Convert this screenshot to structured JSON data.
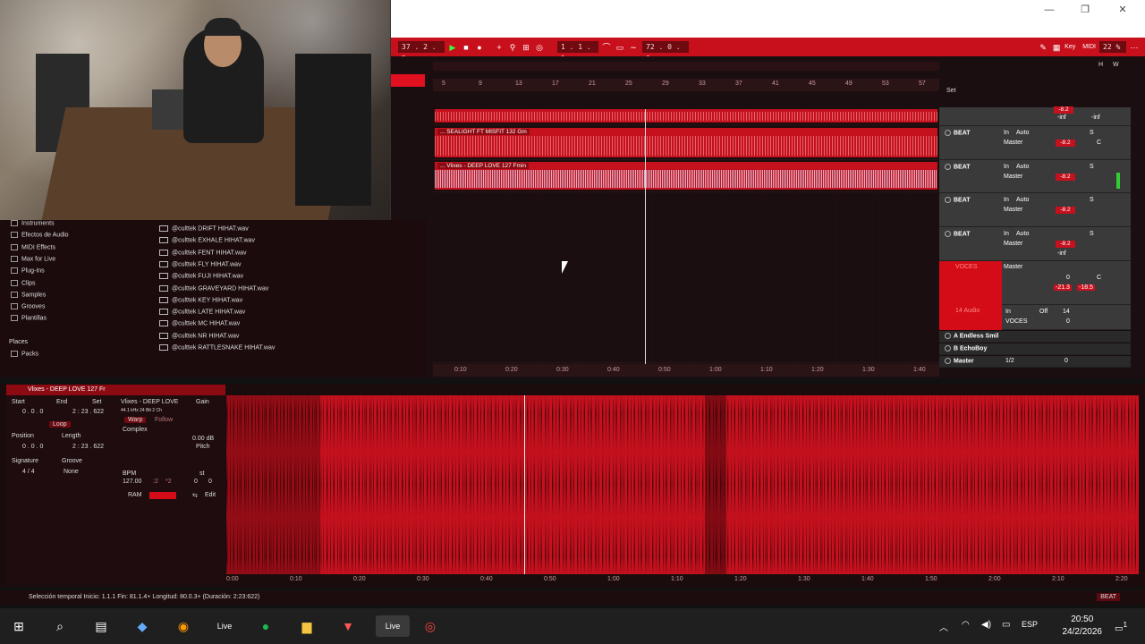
{
  "window": {
    "minimize": "—",
    "restore": "❐",
    "close": "✕"
  },
  "transport": {
    "position": "37 . 2 . 2",
    "loop_start": "1 . 1 . 1",
    "tempo_field": "72 . 0 . 0",
    "key_label": "Key",
    "midi_label": "MIDI",
    "cpu": "22 %",
    "h_label": "H",
    "w_label": "W"
  },
  "session": {
    "set_label": "Set",
    "ruler_marks": [
      "5",
      "9",
      "13",
      "17",
      "21",
      "25",
      "29",
      "33",
      "37",
      "41",
      "45",
      "49",
      "53",
      "57"
    ],
    "time_marks": [
      "0:10",
      "0:20",
      "0:30",
      "0:40",
      "0:50",
      "1:00",
      "1:10",
      "1:20",
      "1:30",
      "1:40"
    ],
    "tracks": [
      {
        "clip": "",
        "name": "BEAT"
      },
      {
        "clip": "... SEALIGHT FT MISFIT 132 Gm",
        "name": "BEAT"
      },
      {
        "clip": "... Vlixes - DEEP LOVE 127 Fmin",
        "name": "BEAT"
      },
      {
        "clip": "",
        "name": "BEAT"
      },
      {
        "clip": "",
        "name": "VOCES"
      },
      {
        "clip": "",
        "name": "14 Audio"
      }
    ],
    "returns": [
      {
        "name": "A Endless Smil"
      },
      {
        "name": "B EchoBoy"
      },
      {
        "name": "Master"
      }
    ]
  },
  "mixer": {
    "in_label": "In",
    "auto_label": "Auto",
    "off_label": "Off",
    "master_label": "Master",
    "voces_label": "VOCES",
    "vol_default": "-8.2",
    "inf": "-inf",
    "center": "C",
    "s_label": "S",
    "half": "1/2",
    "zero": "0",
    "v1": "-21.3",
    "v2": "-18.5",
    "num14": "14"
  },
  "browser": {
    "categories": [
      "Instruments",
      "Efectos de Audio",
      "MIDI Effects",
      "Max for Live",
      "Plug-Ins",
      "Clips",
      "Samples",
      "Grooves",
      "Plantillas"
    ],
    "places_label": "Places",
    "packs_label": "Packs",
    "files": [
      "@culttek DRIFT HIHAT.wav",
      "@culttek EXHALE HIHAT.wav",
      "@culttek FENT HIHAT.wav",
      "@culttek FLY HIHAT.wav",
      "@culttek FUJI HIHAT.wav",
      "@culttek GRAVEYARD HIHAT.wav",
      "@culttek KEY HIHAT.wav",
      "@culttek LATE HIHAT.wav",
      "@culttek MC HIHAT.wav",
      "@culttek NR HIHAT.wav",
      "@culttek RATTLESNAKE HIHAT.wav"
    ]
  },
  "clip": {
    "title": "Vlixes - DEEP LOVE 127 Fr",
    "sample_name": "Vlixes - DEEP LOVE",
    "sample_info": "44.1 kHz  24 Bit  2 Ch",
    "gain_label": "Gain",
    "gain_value": "0.00 dB",
    "pitch_label": "Pitch",
    "start_label": "Start",
    "end_label": "End",
    "set_label": "Set",
    "start_value": "0 .  0 .  0",
    "end_value": "2 : 23 . 622",
    "loop_label": "Loop",
    "position_label": "Position",
    "length_label": "Length",
    "position_value": "0 .  0 .  0",
    "length_value": "2 : 23 . 622",
    "signature_label": "Signature",
    "groove_label": "Groove",
    "signature_value": "4  /  4",
    "groove_value": "None",
    "warp_label": "Warp",
    "follow_label": "Follow",
    "mode": "Complex",
    "bpm_label": "BPM",
    "bpm_value": "127.00",
    "half_label": ":2",
    "double_label": "*2",
    "ram_label": "RAM",
    "edit_label": "Edit",
    "st_label": "st",
    "pitch_st": "0",
    "pitch_ct": "0",
    "ruler": [
      "0:00",
      "0:10",
      "0:20",
      "0:30",
      "0:40",
      "0:50",
      "1:00",
      "1:10",
      "1:20",
      "1:30",
      "1:40",
      "1:50",
      "2:00",
      "2:10",
      "2:20"
    ]
  },
  "status": {
    "text": "Selección temporal   Inicio: 1.1.1   Fin: 81.1.4+   Longitud: 80.0.3+ (Duración: 2:23:622)",
    "beat": "BEAT"
  },
  "taskbar": {
    "live_label": "Live",
    "language": "ESP",
    "time": "20:50",
    "date": "24/2/2026",
    "notifications": "1"
  },
  "colors": {
    "accent": "#c8101c",
    "dark": "#1b0e10"
  }
}
